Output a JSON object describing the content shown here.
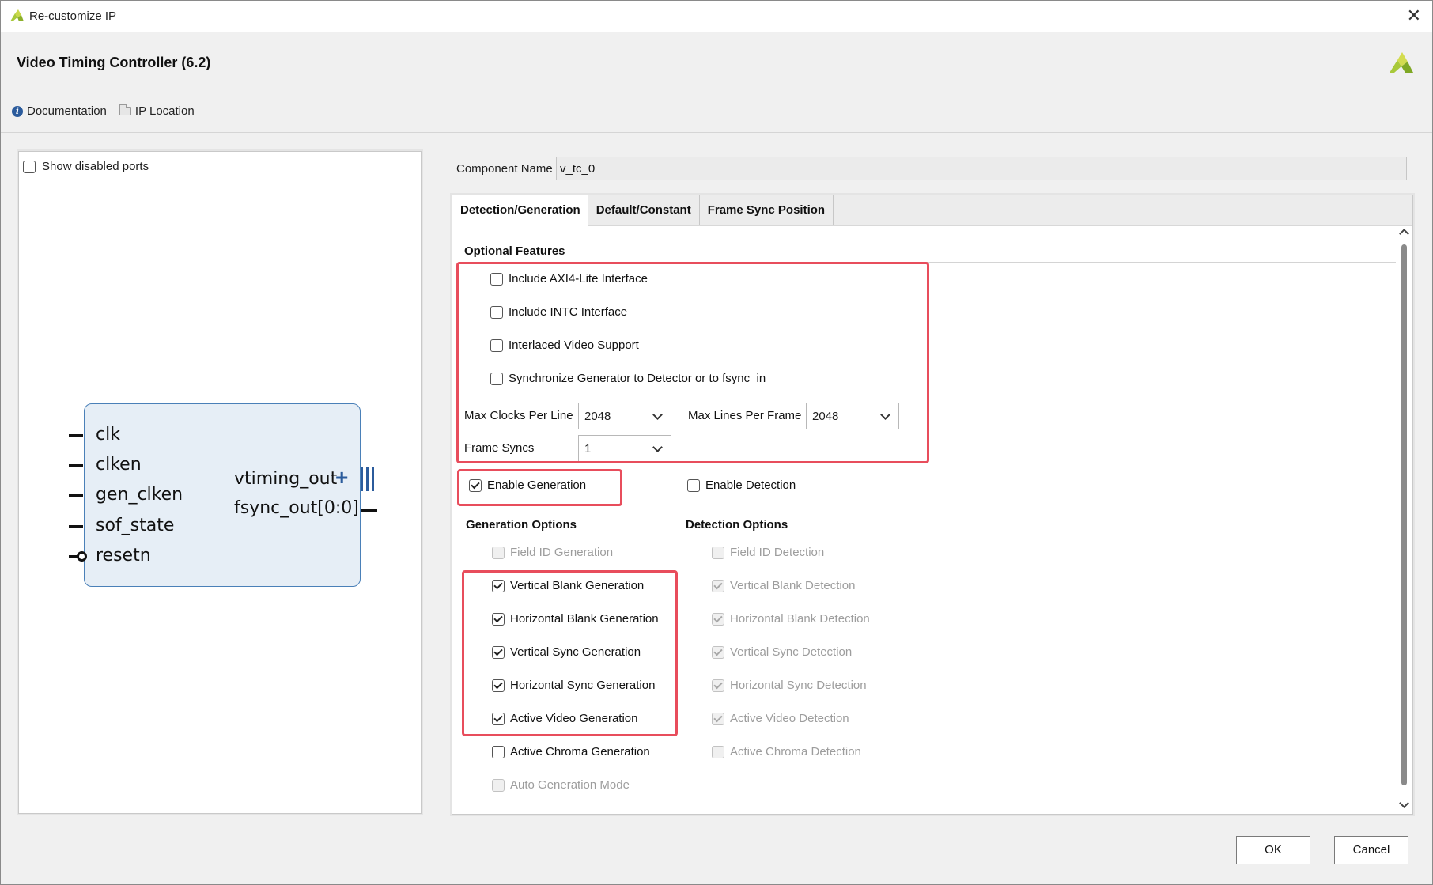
{
  "window": {
    "title": "Re-customize IP",
    "close_icon": "close-icon"
  },
  "header": {
    "ip_title": "Video Timing Controller (6.2)",
    "links": [
      {
        "label": "Documentation",
        "icon": "info-icon"
      },
      {
        "label": "IP Location",
        "icon": "folder-icon"
      }
    ]
  },
  "symbol_panel": {
    "show_disabled_ports": {
      "label": "Show disabled ports",
      "checked": false
    },
    "inputs": [
      "clk",
      "clken",
      "gen_clken",
      "sof_state",
      "resetn"
    ],
    "outputs": [
      "vtiming_out",
      "fsync_out[0:0]"
    ]
  },
  "component": {
    "label": "Component Name",
    "value": "v_tc_0"
  },
  "tabs": [
    "Detection/Generation",
    "Default/Constant",
    "Frame Sync Position"
  ],
  "active_tab": "Detection/Generation",
  "optional_features": {
    "title": "Optional Features",
    "options": [
      {
        "label": "Include AXI4-Lite Interface",
        "checked": false
      },
      {
        "label": "Include INTC Interface",
        "checked": false
      },
      {
        "label": "Interlaced Video Support",
        "checked": false
      },
      {
        "label": "Synchronize Generator to Detector or to fsync_in",
        "checked": false
      }
    ],
    "max_clocks_label": "Max Clocks Per Line",
    "max_clocks_value": "2048",
    "max_lines_label": "Max Lines Per Frame",
    "max_lines_value": "2048",
    "frame_syncs_label": "Frame Syncs",
    "frame_syncs_value": "1"
  },
  "enable_generation": {
    "label": "Enable Generation",
    "checked": true
  },
  "enable_detection": {
    "label": "Enable Detection",
    "checked": false
  },
  "generation_options": {
    "title": "Generation Options",
    "options": [
      {
        "label": "Field ID Generation",
        "checked": false,
        "enabled": false
      },
      {
        "label": "Vertical Blank Generation",
        "checked": true,
        "enabled": true
      },
      {
        "label": "Horizontal Blank Generation",
        "checked": true,
        "enabled": true
      },
      {
        "label": "Vertical Sync Generation",
        "checked": true,
        "enabled": true
      },
      {
        "label": "Horizontal Sync Generation",
        "checked": true,
        "enabled": true
      },
      {
        "label": "Active Video Generation",
        "checked": true,
        "enabled": true
      },
      {
        "label": "Active Chroma Generation",
        "checked": false,
        "enabled": true
      },
      {
        "label": "Auto Generation Mode",
        "checked": false,
        "enabled": false
      }
    ]
  },
  "detection_options": {
    "title": "Detection Options",
    "options": [
      {
        "label": "Field ID Detection",
        "checked": false,
        "enabled": false
      },
      {
        "label": "Vertical Blank Detection",
        "checked": true,
        "enabled": false
      },
      {
        "label": "Horizontal Blank Detection",
        "checked": true,
        "enabled": false
      },
      {
        "label": "Vertical Sync Detection",
        "checked": true,
        "enabled": false
      },
      {
        "label": "Horizontal Sync Detection",
        "checked": true,
        "enabled": false
      },
      {
        "label": "Active Video Detection",
        "checked": true,
        "enabled": false
      },
      {
        "label": "Active Chroma Detection",
        "checked": false,
        "enabled": false
      }
    ]
  },
  "buttons": {
    "ok": "OK",
    "cancel": "Cancel"
  },
  "colors": {
    "highlight": "#e84d5c",
    "block_border": "#4a80b8",
    "block_fill": "#e6eef6"
  }
}
